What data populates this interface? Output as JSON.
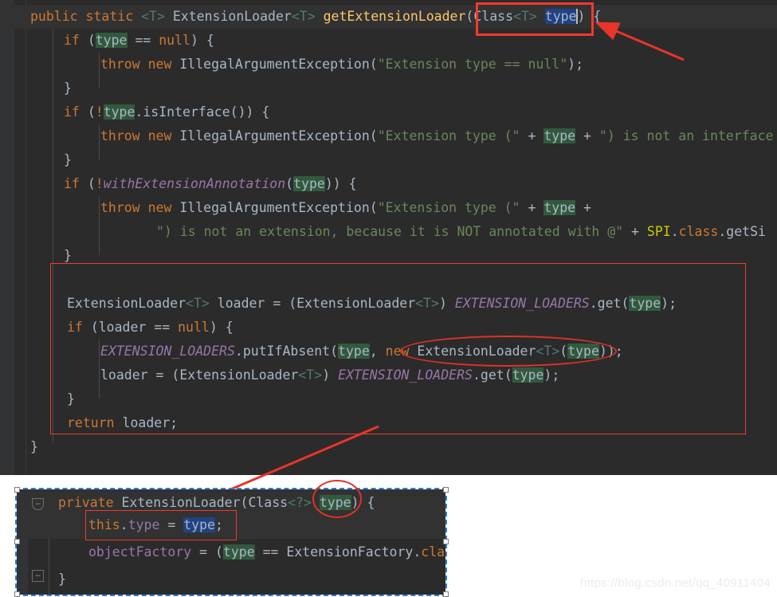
{
  "app": {
    "theme": "darcula",
    "accent_red": "#f23a2f",
    "selection_blue": "#214283",
    "usage_highlight_green": "#32593d",
    "editor_background": "#2b2b2b",
    "gutter_background": "#313335"
  },
  "editor": {
    "name": "java-source-editor",
    "lines": [
      "public static <T> ExtensionLoader<T> getExtensionLoader(Class<T> type) {",
      "    if (type == null) {",
      "        throw new IllegalArgumentException(\"Extension type == null\");",
      "    }",
      "    if (!type.isInterface()) {",
      "        throw new IllegalArgumentException(\"Extension type (\" + type + \") is not an interface",
      "    }",
      "    if (!withExtensionAnnotation(type)) {",
      "        throw new IllegalArgumentException(\"Extension type (\" + type +",
      "            \") is not an extension, because it is NOT annotated with @\" + SPI.class.getSi",
      "    }",
      "",
      "    ExtensionLoader<T> loader = (ExtensionLoader<T>) EXTENSION_LOADERS.get(type);",
      "    if (loader == null) {",
      "        EXTENSION_LOADERS.putIfAbsent(type, new ExtensionLoader<T>(type));",
      "        loader = (ExtensionLoader<T>) EXTENSION_LOADERS.get(type);",
      "    }",
      "    return loader;",
      "}"
    ],
    "selected_text": "type",
    "caret_after": "type"
  },
  "paste_panel": {
    "name": "pasted-screenshot-selection",
    "lines": [
      "    private ExtensionLoader(Class<?> type) {",
      "        this.type = type;",
      "        objectFactory = (type == ExtensionFactory.cla",
      "    }"
    ],
    "selected_text": "type"
  },
  "annotations": {
    "box_signature_param": "Class<T> type",
    "box_loader_block": "ExtensionLoader lookup block",
    "ellipse_new_loader": "new ExtensionLoader<T>(type)",
    "ellipse_ctor_param": "type",
    "box_this_type": "this.type = type;",
    "arrow_count": 3
  },
  "watermark": {
    "text": "https://blog.csdn.net/qq_40911404"
  },
  "tokens": {
    "kw_public": "public",
    "kw_static": "static",
    "kw_if": "if",
    "kw_throw": "throw",
    "kw_new": "new",
    "kw_null": "null",
    "kw_return": "return",
    "kw_private": "private",
    "kw_this": "this",
    "type_name": "type",
    "class_extension_loader": "ExtensionLoader",
    "method_get_extension_loader": "getExtensionLoader",
    "static_field": "EXTENSION_LOADERS",
    "class_spi": "SPI"
  }
}
